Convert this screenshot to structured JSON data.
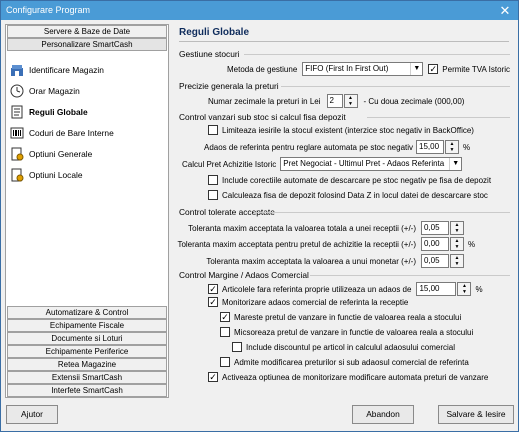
{
  "window": {
    "title": "Configurare Program",
    "close_label": "✕"
  },
  "sidebar": {
    "top_tabs": [
      {
        "label": "Servere & Baze de Date"
      },
      {
        "label": "Personalizare SmartCash"
      }
    ],
    "items": [
      {
        "label": "Identificare Magazin",
        "icon": "store-icon"
      },
      {
        "label": "Orar Magazin",
        "icon": "clock-icon"
      },
      {
        "label": "Reguli Globale",
        "icon": "document-icon"
      },
      {
        "label": "Coduri de Bare Interne",
        "icon": "barcode-icon"
      },
      {
        "label": "Optiuni Generale",
        "icon": "settings-doc-icon"
      },
      {
        "label": "Optiuni Locale",
        "icon": "settings-doc-icon"
      }
    ],
    "bottom_tabs": [
      {
        "label": "Automatizare & Control"
      },
      {
        "label": "Echipamente Fiscale"
      },
      {
        "label": "Documente si Loturi"
      },
      {
        "label": "Echipamente Periferice"
      },
      {
        "label": "Retea Magazine"
      },
      {
        "label": "Extensii SmartCash"
      },
      {
        "label": "Interfete SmartCash"
      }
    ]
  },
  "main": {
    "title": "Reguli Globale",
    "stock": {
      "section": "Gestiune stocuri",
      "method_label": "Metoda de gestiune",
      "method_value": "FIFO (First In First Out)",
      "vat_label": "Permite TVA Istoric",
      "vat_checked": true
    },
    "precision": {
      "section": "Precizie generala la preturi",
      "decimals_label": "Numar zecimale la preturi in Lei",
      "decimals_value": "2",
      "decimals_note": "- Cu doua zecimale (000,00)"
    },
    "sales_control": {
      "section": "Control vanzari sub stoc si calcul fisa depozit",
      "limit_label": "Limiteaza iesirile la stocul existent (interzice stoc negativ in BackOffice)",
      "limit_checked": false,
      "markup_label": "Adaos de referinta pentru reglare automata pe stoc negativ",
      "markup_value": "15,00",
      "markup_unit": "%",
      "calc_label": "Calcul Pret Achizitie Istoric",
      "calc_value": "Pret Negociat - Ultimul Pret - Adaos Referinta",
      "include_corr_label": "Include corectiile automate de descarcare pe stoc negativ pe fisa de depozit",
      "include_corr_checked": false,
      "calc_date_label": "Calculeaza fisa de depozit folosind Data Z in locul datei de descarcare stoc",
      "calc_date_checked": false
    },
    "tolerance": {
      "section": "Control tolerate acceptate",
      "rows": [
        {
          "label": "Toleranta maxim acceptata la valoarea totala a unei receptii (+/-)",
          "value": "0,05",
          "unit": ""
        },
        {
          "label": "Toleranta maxim acceptata pentru pretul de achizitie la receptii (+/-)",
          "value": "0,00",
          "unit": "%"
        },
        {
          "label": "Toleranta maxim acceptata la valoarea a unui monetar (+/-)",
          "value": "0,05",
          "unit": ""
        }
      ]
    },
    "margin": {
      "section": "Control Margine / Adaos Comercial",
      "own_markup_label": "Articolele fara referinta proprie utilizeaza un adaos de",
      "own_markup_checked": true,
      "own_markup_value": "15,00",
      "own_markup_unit": "%",
      "options": [
        {
          "label": "Monitorizare adaos comercial de referinta la receptie",
          "checked": true,
          "indent": 0
        },
        {
          "label": "Mareste pretul de vanzare in functie de valoarea reala a stocului",
          "checked": true,
          "indent": 1
        },
        {
          "label": "Micsoreaza pretul de vanzare in functie de valoarea reala a stocului",
          "checked": false,
          "indent": 1
        },
        {
          "label": "Include discountul pe articol in calculul adaosului comercial",
          "checked": false,
          "indent": 2
        },
        {
          "label": "Admite modificarea preturilor si sub adaosul comercial de referinta",
          "checked": false,
          "indent": 1
        },
        {
          "label": "Activeaza optiunea de monitorizare modificare automata preturi de vanzare",
          "checked": true,
          "indent": 0
        }
      ]
    }
  },
  "footer": {
    "help_label": "Ajutor",
    "cancel_label": "Abandon",
    "save_label": "Salvare & Iesire"
  }
}
